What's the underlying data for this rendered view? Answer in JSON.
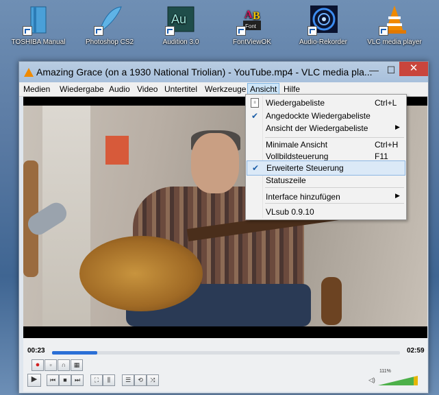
{
  "desktop": {
    "icons": [
      {
        "label": "TOSHIBA Manual",
        "icon": "book-icon"
      },
      {
        "label": "Photoshop CS2",
        "icon": "feather-icon"
      },
      {
        "label": "Audition 3.0",
        "icon": "au-icon",
        "badge": "Au"
      },
      {
        "label": "FontViewOK",
        "icon": "fontview-icon"
      },
      {
        "label": "Audio-Rekorder",
        "icon": "record-icon"
      },
      {
        "label": "VLC media player",
        "icon": "vlc-cone-icon"
      }
    ]
  },
  "window": {
    "title": "Amazing Grace (on a 1930 National Triolian) - YouTube.mp4 - VLC media pla...",
    "minimize": "—",
    "maximize": "☐",
    "close": "✕"
  },
  "menubar": {
    "items": [
      "Medien",
      "Wiedergabe",
      "Audio",
      "Video",
      "Untertitel",
      "Werkzeuge",
      "Ansicht",
      "Hilfe"
    ],
    "active": "Ansicht"
  },
  "view_menu": {
    "items": [
      {
        "label": "Wiedergabeliste",
        "shortcut": "Ctrl+L",
        "icon": "playlist-icon"
      },
      {
        "label": "Angedockte Wiedergabeliste",
        "checked": true
      },
      {
        "label": "Ansicht der Wiedergabeliste",
        "submenu": true
      },
      {
        "label": "Minimale Ansicht",
        "shortcut": "Ctrl+H"
      },
      {
        "label": "Vollbildsteuerung",
        "shortcut": "F11"
      },
      {
        "label": "Erweiterte Steuerung",
        "checked": true,
        "highlighted": true
      },
      {
        "label": "Statuszeile"
      },
      {
        "label": "Interface hinzufügen",
        "submenu": true
      },
      {
        "label": "VLsub 0.9.10"
      }
    ]
  },
  "player": {
    "elapsed": "00:23",
    "total": "02:59",
    "progress": 0.13,
    "volume_label": "111%",
    "volume": 1.11
  },
  "colors": {
    "accent": "#2b6fd6",
    "close_button": "#c9453c",
    "vlc_orange": "#f08a00"
  }
}
